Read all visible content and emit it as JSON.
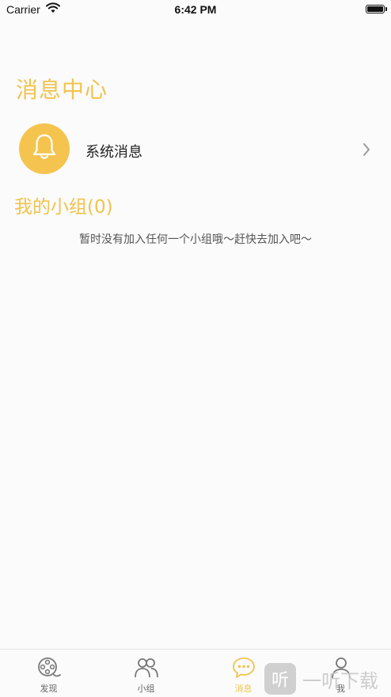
{
  "status_bar": {
    "carrier": "Carrier",
    "time": "6:42 PM"
  },
  "page": {
    "title": "消息中心"
  },
  "system_message": {
    "label": "系统消息",
    "icon": "bell-icon",
    "accent_color": "#f4c44f"
  },
  "groups": {
    "title": "我的小组(0)",
    "empty_hint": "暂时没有加入任何一个小组哦～赶快去加入吧～"
  },
  "tab_bar": {
    "tabs": [
      {
        "label": "发现",
        "icon": "film-reel-icon",
        "active": false
      },
      {
        "label": "小组",
        "icon": "people-icon",
        "active": false
      },
      {
        "label": "消息",
        "icon": "chat-bubble-icon",
        "active": true
      },
      {
        "label": "我",
        "icon": "person-icon",
        "active": false
      }
    ]
  },
  "watermark": {
    "logo_glyph": "听",
    "text": "一听下载"
  },
  "colors": {
    "accent": "#f2c34d",
    "background": "#fbfbfb"
  }
}
